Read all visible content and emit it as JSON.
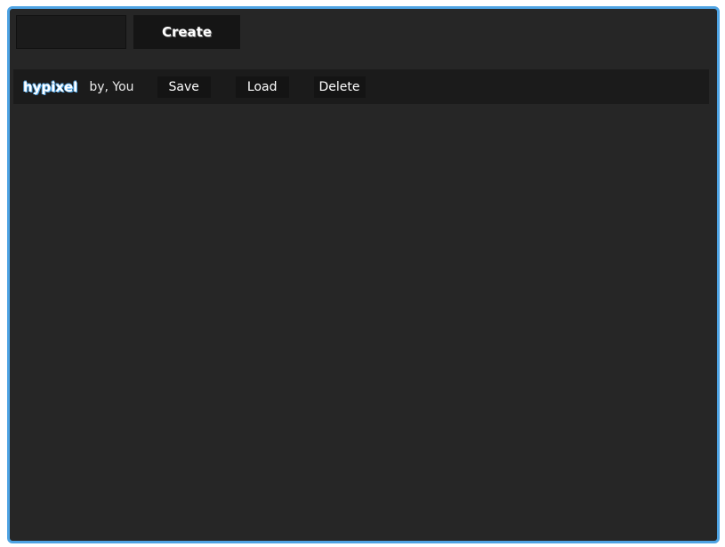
{
  "create_form": {
    "name_input_value": "",
    "create_label": "Create"
  },
  "profile": {
    "name": "hypixel",
    "owner": "by, You",
    "save_label": "Save",
    "load_label": "Load",
    "delete_label": "Delete"
  },
  "colors": {
    "accent": "#4ea3e3",
    "background": "#262626",
    "bar": "#1b1b1b",
    "button": "#141414"
  }
}
